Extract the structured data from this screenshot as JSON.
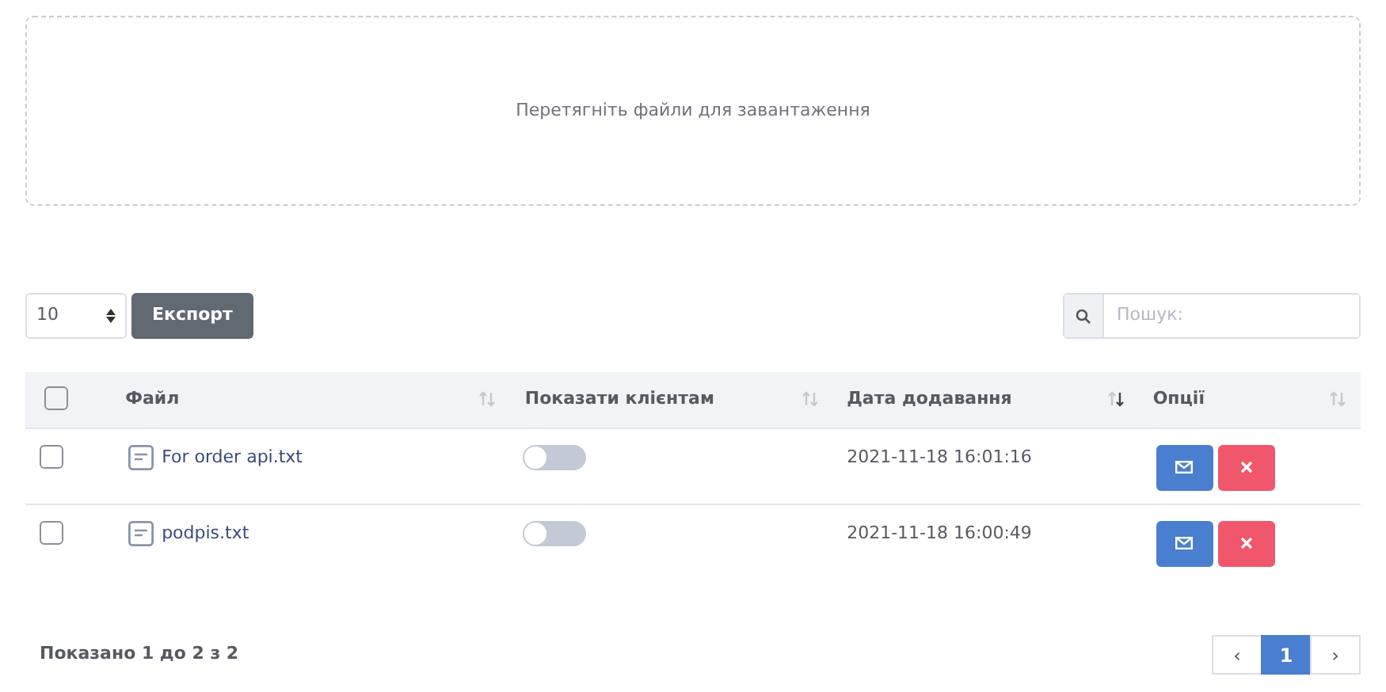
{
  "dropzone": {
    "text": "Перетягніть файли для завантаження"
  },
  "toolbar": {
    "page_size": "10",
    "export_button": "Експорт",
    "search": {
      "placeholder": "Пошук:"
    }
  },
  "table": {
    "select_all": {
      "checked": false
    },
    "columns": [
      {
        "label": "Файл",
        "sorted": false
      },
      {
        "label": "Показати клієнтам",
        "sorted": false
      },
      {
        "label": "Дата додавання",
        "sorted": true
      },
      {
        "label": "Опції",
        "sorted": false
      }
    ],
    "rows": [
      {
        "checked": false,
        "file": "For order api.txt",
        "show_to_clients": false,
        "date": "2021-11-18 16:01:16"
      },
      {
        "checked": false,
        "file": "podpis.txt",
        "show_to_clients": false,
        "date": "2021-11-18 16:00:49"
      }
    ]
  },
  "footer": {
    "info": "Показано 1 до 2 з 2",
    "pagination": [
      {
        "label": "‹",
        "selected": false
      },
      {
        "label": "1",
        "selected": true
      },
      {
        "label": "›",
        "selected": false
      }
    ]
  }
}
